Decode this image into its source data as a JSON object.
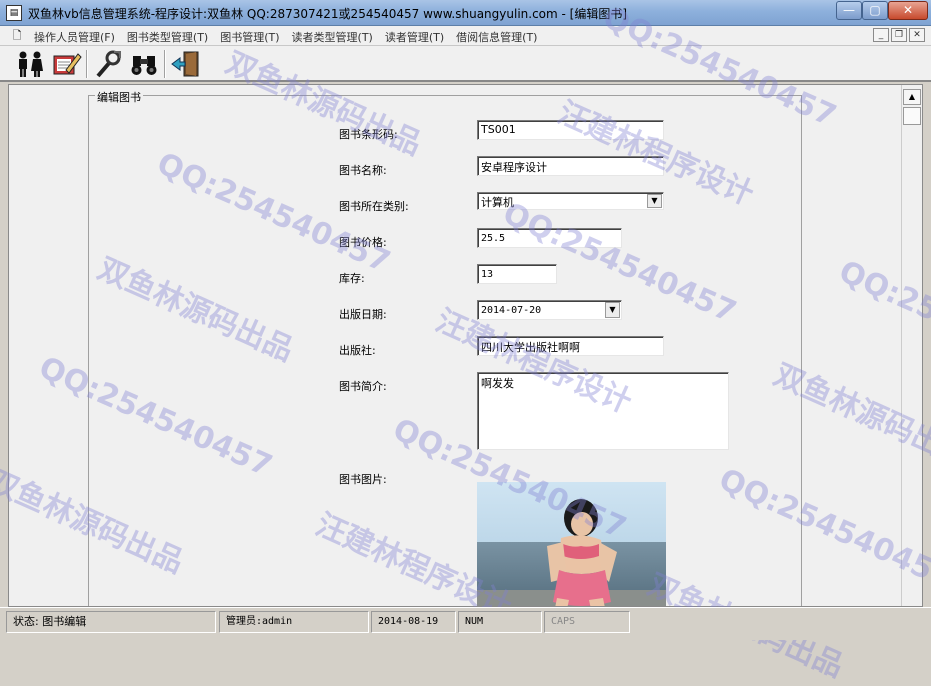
{
  "window": {
    "title": "双鱼林vb信息管理系统-程序设计:双鱼林 QQ:287307421或254540457 www.shuangyulin.com - [编辑图书]",
    "min_label": "—",
    "max_label": "▢",
    "close_label": "✕"
  },
  "menu": {
    "items": [
      "操作人员管理(F)",
      "图书类型管理(T)",
      "图书管理(T)",
      "读者类型管理(T)",
      "读者管理(T)",
      "借阅信息管理(T)"
    ]
  },
  "toolbar": {
    "buttons": [
      "people-icon",
      "edit-book-icon",
      "tools-icon",
      "binoculars-icon",
      "exit-door-icon"
    ]
  },
  "form": {
    "group_title": "编辑图书",
    "barcode": {
      "label": "图书条形码:",
      "value": "TS001"
    },
    "name": {
      "label": "图书名称:",
      "value": "安卓程序设计"
    },
    "category": {
      "label": "图书所在类别:",
      "value": "计算机"
    },
    "price": {
      "label": "图书价格:",
      "value": "25.5"
    },
    "stock": {
      "label": "库存:",
      "value": "13"
    },
    "publish_date": {
      "label": "出版日期:",
      "value": "2014-07-20"
    },
    "publisher": {
      "label": "出版社:",
      "value": "四川大学出版社啊啊"
    },
    "intro": {
      "label": "图书简介:",
      "value": "啊发发"
    },
    "photo": {
      "label": "图书图片:"
    }
  },
  "statusbar": {
    "state": "状态:  图书编辑",
    "admin": "管理员:admin",
    "date": "2014-08-19",
    "num": "NUM",
    "caps": "CAPS"
  },
  "watermark": {
    "qq": "QQ:254540457",
    "author": "汪建林程序设计",
    "source": "双鱼林源码出品"
  },
  "colors": {
    "titlebar": "#8db0dc",
    "watermark": "#8282d2",
    "window_bg": "#f0f0f0"
  }
}
